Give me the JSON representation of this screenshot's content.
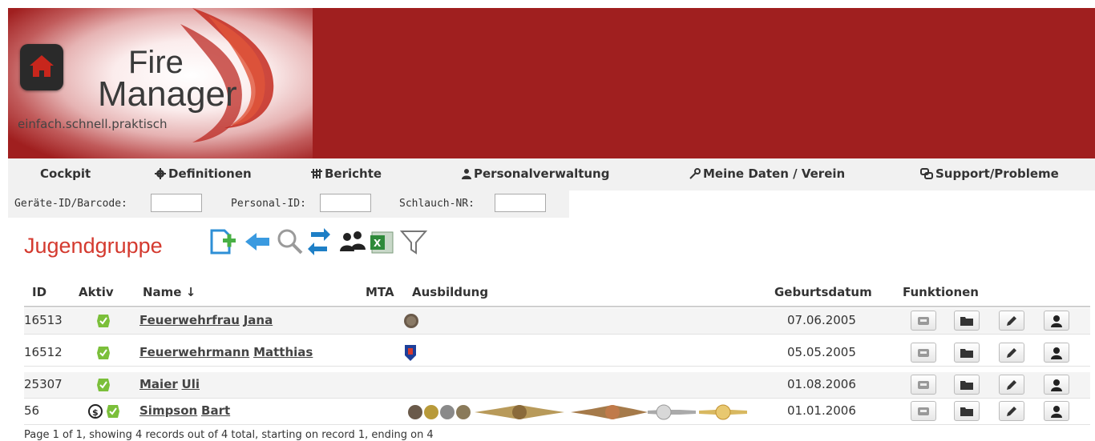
{
  "brand": {
    "name_line1": "Fire",
    "name_line2": "Manager",
    "tagline": "einfach.schnell.praktisch"
  },
  "nav": {
    "items": [
      {
        "label": "Cockpit",
        "icon": "none"
      },
      {
        "label": "Definitionen",
        "icon": "gear-icon"
      },
      {
        "label": "Berichte",
        "icon": "sliders-icon"
      },
      {
        "label": "Personalverwaltung",
        "icon": "person-icon"
      },
      {
        "label": "Meine Daten / Verein",
        "icon": "key-icon"
      },
      {
        "label": "Support/Probleme",
        "icon": "support-icon"
      }
    ]
  },
  "quick_search": {
    "device_label": "Geräte-ID/Barcode:",
    "device_value": "",
    "person_label": "Personal-ID:",
    "person_value": "",
    "hose_label": "Schlauch-NR:",
    "hose_value": ""
  },
  "page": {
    "title": "Jugendgruppe",
    "toolbar_icons": [
      "add-icon",
      "back-arrow-icon",
      "search-icon",
      "refresh-icon",
      "group-icon",
      "excel-export-icon",
      "filter-icon"
    ]
  },
  "table": {
    "columns": {
      "id": "ID",
      "aktiv": "Aktiv",
      "name": "Name ↓",
      "mta": "MTA",
      "ausbildung": "Ausbildung",
      "geburtsdatum": "Geburtsdatum",
      "funktionen": "Funktionen"
    },
    "rows": [
      {
        "id": "16513",
        "first": "Feuerwehrfrau",
        "last": "Jana",
        "birth": "07.06.2005",
        "badges": "bronze-medal"
      },
      {
        "id": "16512",
        "first": "Feuerwehrmann",
        "last": "Matthias",
        "birth": "05.05.2005",
        "badges": "blue-crest"
      },
      {
        "id": "25307",
        "first": "Maier",
        "last": "Uli",
        "birth": "01.08.2006",
        "badges": "none"
      },
      {
        "id": "56",
        "first": "Simpson",
        "last": "Bart",
        "birth": "01.01.2006",
        "badges": "many"
      }
    ],
    "function_icons": [
      "card-icon",
      "folder-icon",
      "edit-pencil-icon",
      "person-profile-icon"
    ]
  },
  "pager": {
    "text": "Page 1 of 1, showing 4 records out of 4 total, starting on record 1, ending on 4"
  },
  "colors": {
    "header_bg": "#a01f1f",
    "title_red": "#d43a2f",
    "check_green": "#7bbf3a",
    "icon_blue": "#2e8fd6"
  }
}
